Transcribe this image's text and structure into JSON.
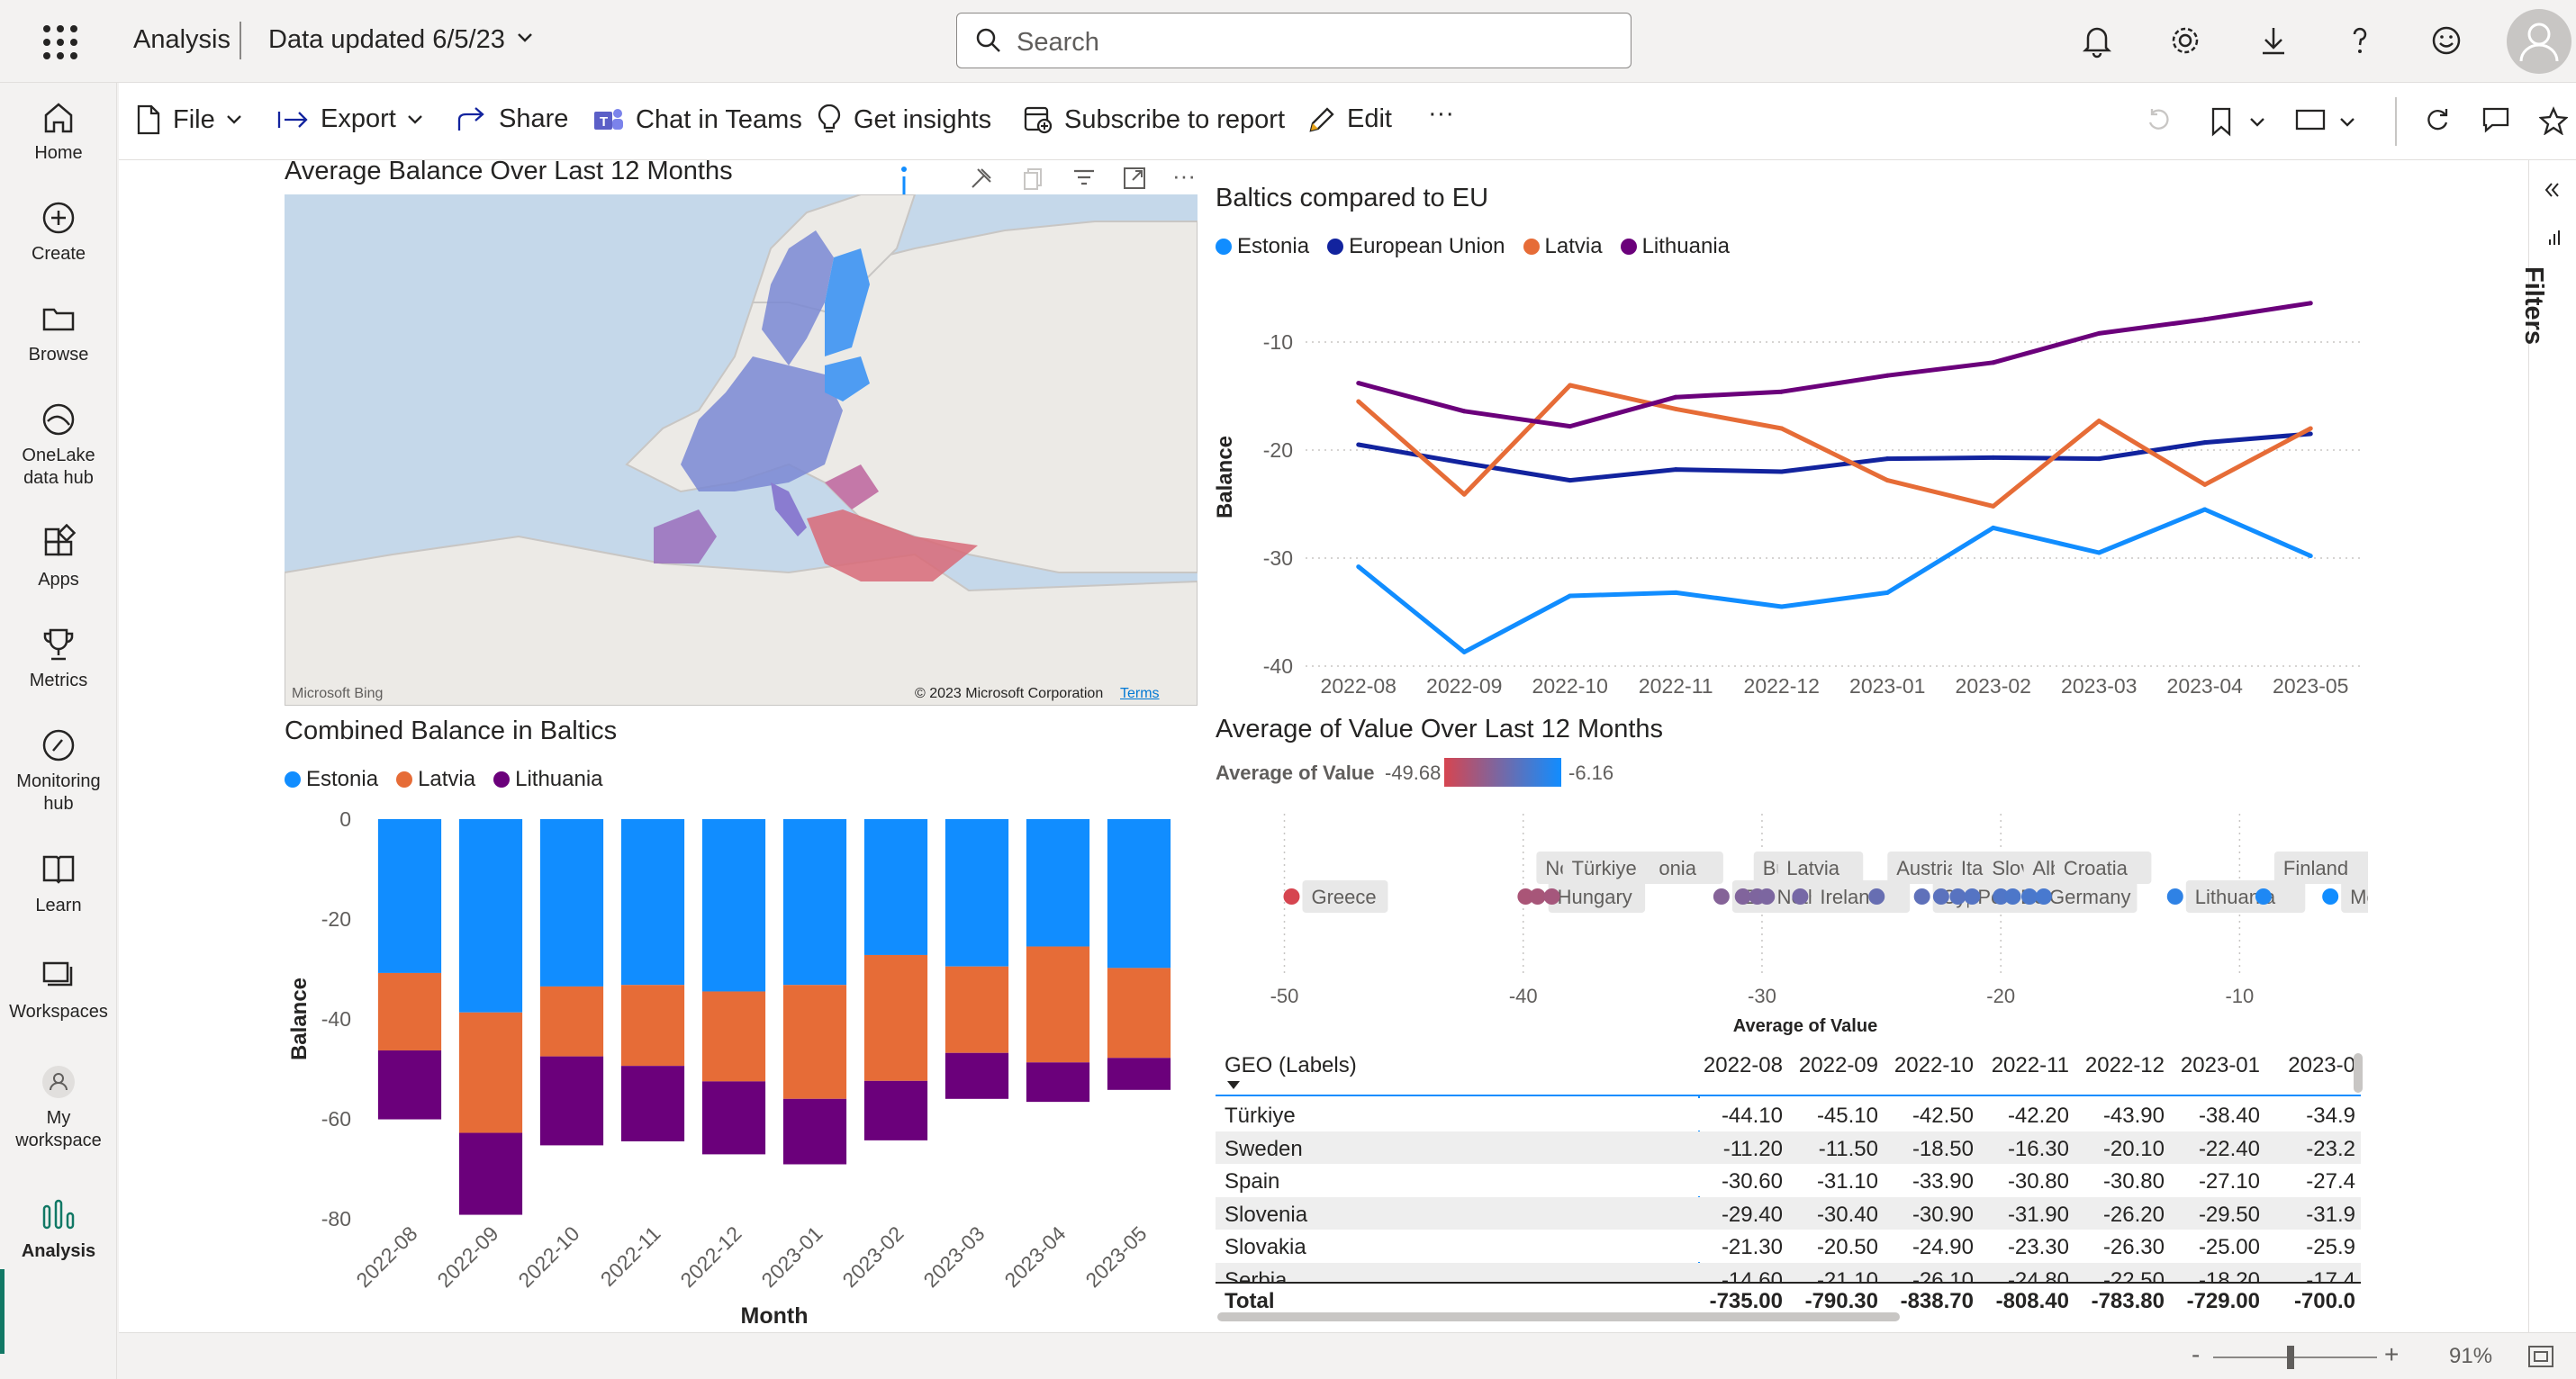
{
  "topbar": {
    "app_name": "Analysis",
    "data_updated": "Data updated 6/5/23",
    "search_placeholder": "Search"
  },
  "nav": [
    {
      "label": "Home",
      "icon": "home-icon"
    },
    {
      "label": "Create",
      "icon": "create-icon"
    },
    {
      "label": "Browse",
      "icon": "browse-icon"
    },
    {
      "label": "OneLake data hub",
      "icon": "onelake-icon"
    },
    {
      "label": "Apps",
      "icon": "apps-icon"
    },
    {
      "label": "Metrics",
      "icon": "trophy-icon"
    },
    {
      "label": "Monitoring hub",
      "icon": "monitoring-icon"
    },
    {
      "label": "Learn",
      "icon": "book-icon"
    },
    {
      "label": "Workspaces",
      "icon": "workspaces-icon"
    },
    {
      "label": "My workspace",
      "icon": "my-workspace-icon"
    },
    {
      "label": "Analysis",
      "icon": "analysis-icon"
    }
  ],
  "toolbar": {
    "file": "File",
    "export": "Export",
    "share": "Share",
    "chat": "Chat in Teams",
    "insights": "Get insights",
    "subscribe": "Subscribe to report",
    "edit": "Edit",
    "more": "···"
  },
  "filters_label": "Filters",
  "status": {
    "zoom": "91%",
    "minus": "-",
    "plus": "+"
  },
  "map": {
    "title": "Average Balance Over Last 12 Months",
    "bing": "Microsoft Bing",
    "copyright": "© 2023 Microsoft Corporation",
    "terms": "Terms"
  },
  "colors": {
    "estonia": "#118dff",
    "eu": "#12239e",
    "latvia": "#e66c37",
    "lithuania": "#6b007b"
  },
  "line_chart": {
    "title": "Baltics compared to EU",
    "chart_data": {
      "type": "line",
      "x": [
        "2022-08",
        "2022-09",
        "2022-10",
        "2022-11",
        "2022-12",
        "2023-01",
        "2023-02",
        "2023-03",
        "2023-04",
        "2023-05"
      ],
      "ylabel": "Balance",
      "ylim": [
        -40,
        -5
      ],
      "yticks": [
        -10,
        -20,
        -30,
        -40
      ],
      "series": [
        {
          "name": "Estonia",
          "values": [
            -30.8,
            -38.7,
            -33.5,
            -33.2,
            -34.5,
            -33.2,
            -27.2,
            -29.5,
            -25.5,
            -29.8
          ]
        },
        {
          "name": "European Union",
          "values": [
            -19.5,
            -21.2,
            -22.8,
            -21.8,
            -22.0,
            -20.8,
            -20.7,
            -20.8,
            -19.3,
            -18.5
          ]
        },
        {
          "name": "Latvia",
          "values": [
            -15.5,
            -24.1,
            -14.0,
            -16.2,
            -18.0,
            -22.8,
            -25.2,
            -17.3,
            -23.2,
            -18.0
          ]
        },
        {
          "name": "Lithuania",
          "values": [
            -13.8,
            -16.4,
            -17.8,
            -15.1,
            -14.6,
            -13.1,
            -11.9,
            -9.2,
            -7.9,
            -6.4
          ]
        }
      ],
      "grid": true,
      "legend": "top-left"
    }
  },
  "bar_chart": {
    "title": "Combined Balance in Baltics",
    "chart_data": {
      "type": "bar",
      "stacked": true,
      "categories": [
        "2022-08",
        "2022-09",
        "2022-10",
        "2022-11",
        "2022-12",
        "2023-01",
        "2023-02",
        "2023-03",
        "2023-04",
        "2023-05"
      ],
      "xlabel": "Month",
      "ylabel": "Balance",
      "ylim": [
        -80,
        0
      ],
      "yticks": [
        0,
        -20,
        -40,
        -60,
        -80
      ],
      "series": [
        {
          "name": "Estonia",
          "values": [
            -30.8,
            -38.7,
            -33.5,
            -33.2,
            -34.5,
            -33.2,
            -27.2,
            -29.5,
            -25.5,
            -29.8
          ]
        },
        {
          "name": "Latvia",
          "values": [
            -15.5,
            -24.1,
            -14.0,
            -16.2,
            -18.0,
            -22.8,
            -25.2,
            -17.3,
            -23.2,
            -18.0
          ]
        },
        {
          "name": "Lithuania",
          "values": [
            -13.8,
            -16.4,
            -17.8,
            -15.1,
            -14.6,
            -13.1,
            -11.9,
            -9.2,
            -7.9,
            -6.4
          ]
        }
      ],
      "legend": "top-left"
    }
  },
  "scatter_chart": {
    "title": "Average of Value Over Last 12 Months",
    "gradient_label": "Average of Value",
    "gradient_min": "-49.68",
    "gradient_max": "-6.16",
    "chart_data": {
      "type": "scatter",
      "xlabel": "Average of Value",
      "xlim": [
        -51,
        -5
      ],
      "xticks": [
        -50,
        -40,
        -30,
        -20,
        -10
      ],
      "points": [
        {
          "label": "Greece",
          "x": -49.7
        },
        {
          "label": "North Macedonia",
          "x": -39.9
        },
        {
          "label": "Hungary",
          "x": -39.4
        },
        {
          "label": "Türkiye",
          "x": -38.8
        },
        {
          "label": "Estonia",
          "x": -31.7
        },
        {
          "label": "Bulgaria",
          "x": -30.8
        },
        {
          "label": "Netherlands",
          "x": -30.2
        },
        {
          "label": "Latvia",
          "x": -29.8
        },
        {
          "label": "Ireland",
          "x": -28.4
        },
        {
          "label": "Austria",
          "x": -25.2
        },
        {
          "label": "Cyprus",
          "x": -23.3
        },
        {
          "label": "Italy",
          "x": -22.5
        },
        {
          "label": "Poland",
          "x": -21.8
        },
        {
          "label": "Slovakia",
          "x": -21.2
        },
        {
          "label": "Belgium",
          "x": -20.0
        },
        {
          "label": "Albania",
          "x": -19.5
        },
        {
          "label": "Germany",
          "x": -18.8
        },
        {
          "label": "Croatia",
          "x": -18.2
        },
        {
          "label": "Lithuania",
          "x": -12.7
        },
        {
          "label": "Finland",
          "x": -9.0
        },
        {
          "label": "Montenegro",
          "x": -6.2
        }
      ]
    }
  },
  "table": {
    "header": "GEO (Labels)",
    "columns": [
      "2022-08",
      "2022-09",
      "2022-10",
      "2022-11",
      "2022-12",
      "2023-01",
      "2023-0"
    ],
    "rows": [
      {
        "label": "Türkiye",
        "values": [
          "-44.10",
          "-45.10",
          "-42.50",
          "-42.20",
          "-43.90",
          "-38.40",
          "-34.9"
        ]
      },
      {
        "label": "Sweden",
        "values": [
          "-11.20",
          "-11.50",
          "-18.50",
          "-16.30",
          "-20.10",
          "-22.40",
          "-23.2"
        ]
      },
      {
        "label": "Spain",
        "values": [
          "-30.60",
          "-31.10",
          "-33.90",
          "-30.80",
          "-30.80",
          "-27.10",
          "-27.4"
        ]
      },
      {
        "label": "Slovenia",
        "values": [
          "-29.40",
          "-30.40",
          "-30.90",
          "-31.90",
          "-26.20",
          "-29.50",
          "-31.9"
        ]
      },
      {
        "label": "Slovakia",
        "values": [
          "-21.30",
          "-20.50",
          "-24.90",
          "-23.30",
          "-26.30",
          "-25.00",
          "-25.9"
        ]
      },
      {
        "label": "Serbia",
        "values": [
          "-14.60",
          "-21.10",
          "-26.10",
          "-24.80",
          "-22.50",
          "-18.20",
          "-17.4"
        ]
      }
    ],
    "total": {
      "label": "Total",
      "values": [
        "-735.00",
        "-790.30",
        "-838.70",
        "-808.40",
        "-783.80",
        "-729.00",
        "-700.0"
      ]
    }
  }
}
